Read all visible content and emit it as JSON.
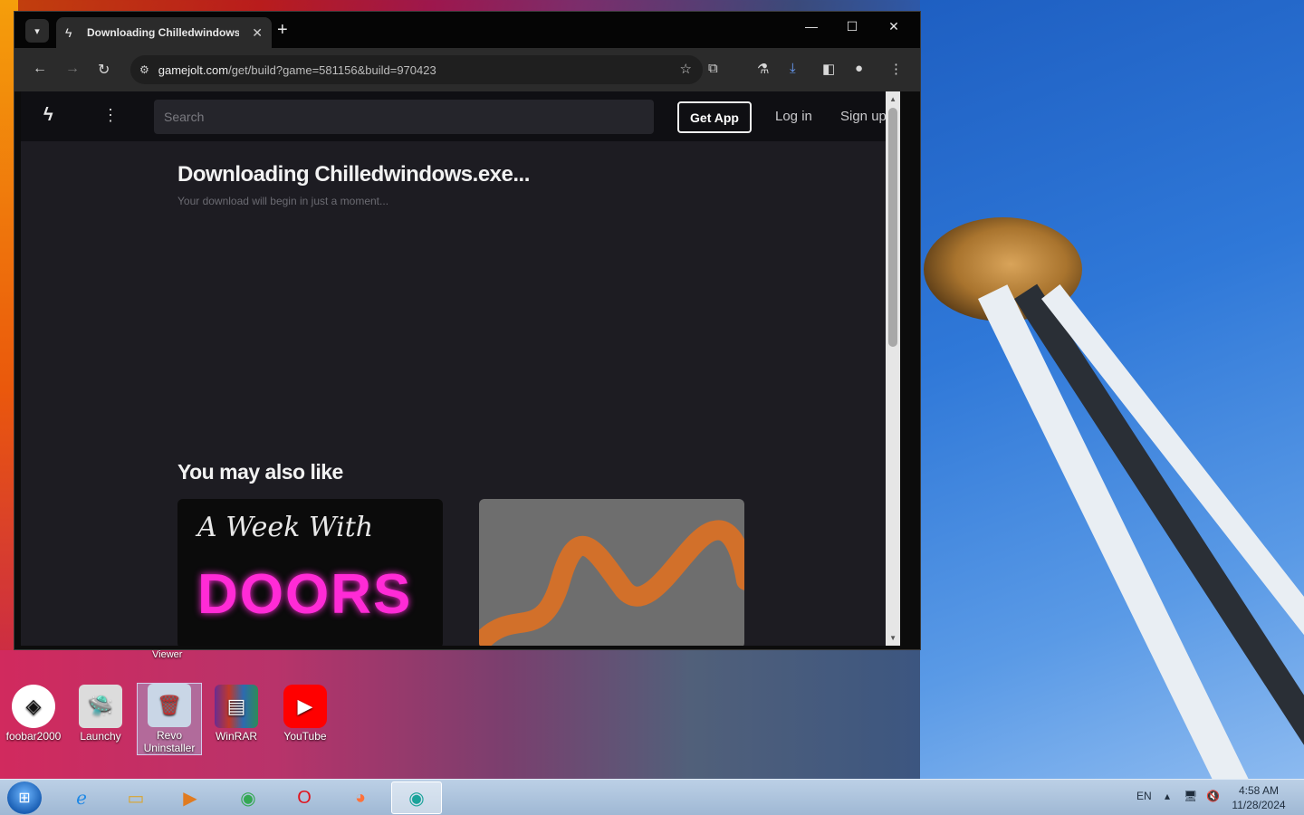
{
  "browser": {
    "tab_title": "Downloading Chilledwindows.exe - Game Jolt",
    "new_tab": "+",
    "url_host": "gamejolt.com",
    "url_path": "/get/build?game=581156&build=970423"
  },
  "site": {
    "search_placeholder": "Search",
    "get_app": "Get App",
    "log_in": "Log in",
    "sign_up": "Sign up",
    "download_title": "Downloading Chilledwindows.exe...",
    "download_subtitle": "Your download will begin in just a moment...",
    "also_like": "You may also like",
    "card1_script": "A Week With",
    "card1_title": "DOORS"
  },
  "desktop": {
    "viewer_label": "Viewer",
    "icons": [
      {
        "label": "foobar2000"
      },
      {
        "label": "Launchy"
      },
      {
        "label": "Revo Uninstaller"
      },
      {
        "label": "WinRAR"
      },
      {
        "label": "YouTube"
      }
    ]
  },
  "taskbar": {
    "lang": "EN",
    "time": "4:58 AM",
    "date": "11/28/2024"
  }
}
